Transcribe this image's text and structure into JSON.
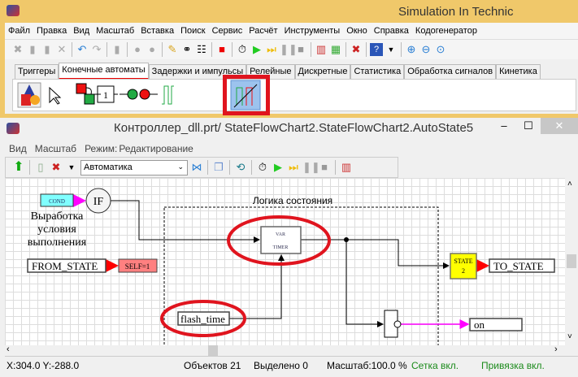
{
  "app": {
    "title": "Simulation In Technic"
  },
  "menu": [
    "Файл",
    "Правка",
    "Вид",
    "Масштаб",
    "Вставка",
    "Поиск",
    "Сервис",
    "Расчёт",
    "Инструменты",
    "Окно",
    "Справка",
    "Кодогенератор"
  ],
  "tabs": [
    {
      "label": "Триггеры"
    },
    {
      "label": "Конечные автоматы",
      "active": true
    },
    {
      "label": "Задержки и импульсы"
    },
    {
      "label": "Релейные"
    },
    {
      "label": "Дискретные"
    },
    {
      "label": "Статистика"
    },
    {
      "label": "Обработка сигналов"
    },
    {
      "label": "Кинетика"
    }
  ],
  "window": {
    "title": "Контроллер_dll.prt/ StateFlowChart2.StateFlowChart2.AutoState5",
    "menu": [
      "Вид",
      "Масштаб",
      "Режим:",
      "Редактирование"
    ],
    "combo_value": "Автоматика"
  },
  "diagram": {
    "cond": "COND",
    "if": "IF",
    "cond_label": [
      "Выработка",
      "условия",
      "выполнения"
    ],
    "group_title": "Логика состояния",
    "var": "VAR",
    "timer": "TIMER",
    "from_state": "FROM_STATE",
    "self": "SELF=1",
    "flash_time": "flash_time",
    "state": "STATE",
    "state_num": "2",
    "to_state": "TO_STATE",
    "on": "on"
  },
  "status": {
    "coords": "X:304.0  Y:-288.0",
    "objects": "Объектов 21",
    "selected": "Выделено 0",
    "scale": "Масштаб:100.0 %",
    "grid": "Сетка вкл.",
    "snap": "Привязка вкл."
  },
  "colors": {
    "highlight": "#e0141e",
    "titlebar": "#f0c86a"
  }
}
